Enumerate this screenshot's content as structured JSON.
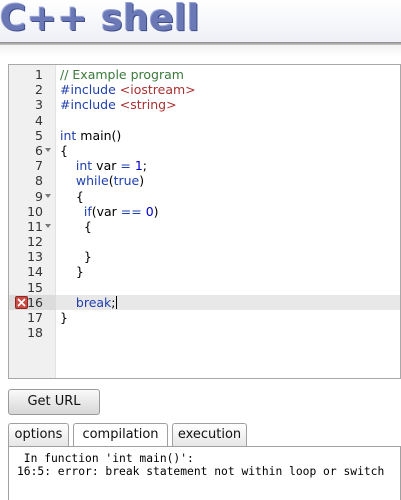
{
  "header": {
    "logo_text": "C++ shell"
  },
  "editor": {
    "lines": [
      {
        "n": "1",
        "code": "// Example program"
      },
      {
        "n": "2",
        "code": "#include <iostream>"
      },
      {
        "n": "3",
        "code": "#include <string>"
      },
      {
        "n": "4",
        "code": ""
      },
      {
        "n": "5",
        "code": "int main()"
      },
      {
        "n": "6",
        "code": "{",
        "fold": true
      },
      {
        "n": "7",
        "code": "    int var = 1;"
      },
      {
        "n": "8",
        "code": "    while(true)"
      },
      {
        "n": "9",
        "code": "    {",
        "fold": true
      },
      {
        "n": "10",
        "code": "      if(var == 0)"
      },
      {
        "n": "11",
        "code": "      {",
        "fold": true
      },
      {
        "n": "12",
        "code": ""
      },
      {
        "n": "13",
        "code": "      }"
      },
      {
        "n": "14",
        "code": "    }"
      },
      {
        "n": "15",
        "code": ""
      },
      {
        "n": "16",
        "code": "    break;",
        "error": true,
        "active": true
      },
      {
        "n": "17",
        "code": "}"
      },
      {
        "n": "18",
        "code": ""
      }
    ],
    "error_icon": "error-x-icon",
    "fold_icon": "fold-arrow-icon"
  },
  "toolbar": {
    "get_url_label": "Get URL"
  },
  "tabs": [
    {
      "label": "options"
    },
    {
      "label": "compilation",
      "selected": true
    },
    {
      "label": "execution"
    }
  ],
  "output": {
    "lines": [
      " In function 'int main()':",
      "16:5: error: break statement not within loop or switch"
    ]
  },
  "colors": {
    "logo": "#6a78b6",
    "comment": "#3b7a3b",
    "keyword": "#1f3faf",
    "string": "#a83030",
    "number": "#0000cd",
    "error": "#c94a43"
  }
}
